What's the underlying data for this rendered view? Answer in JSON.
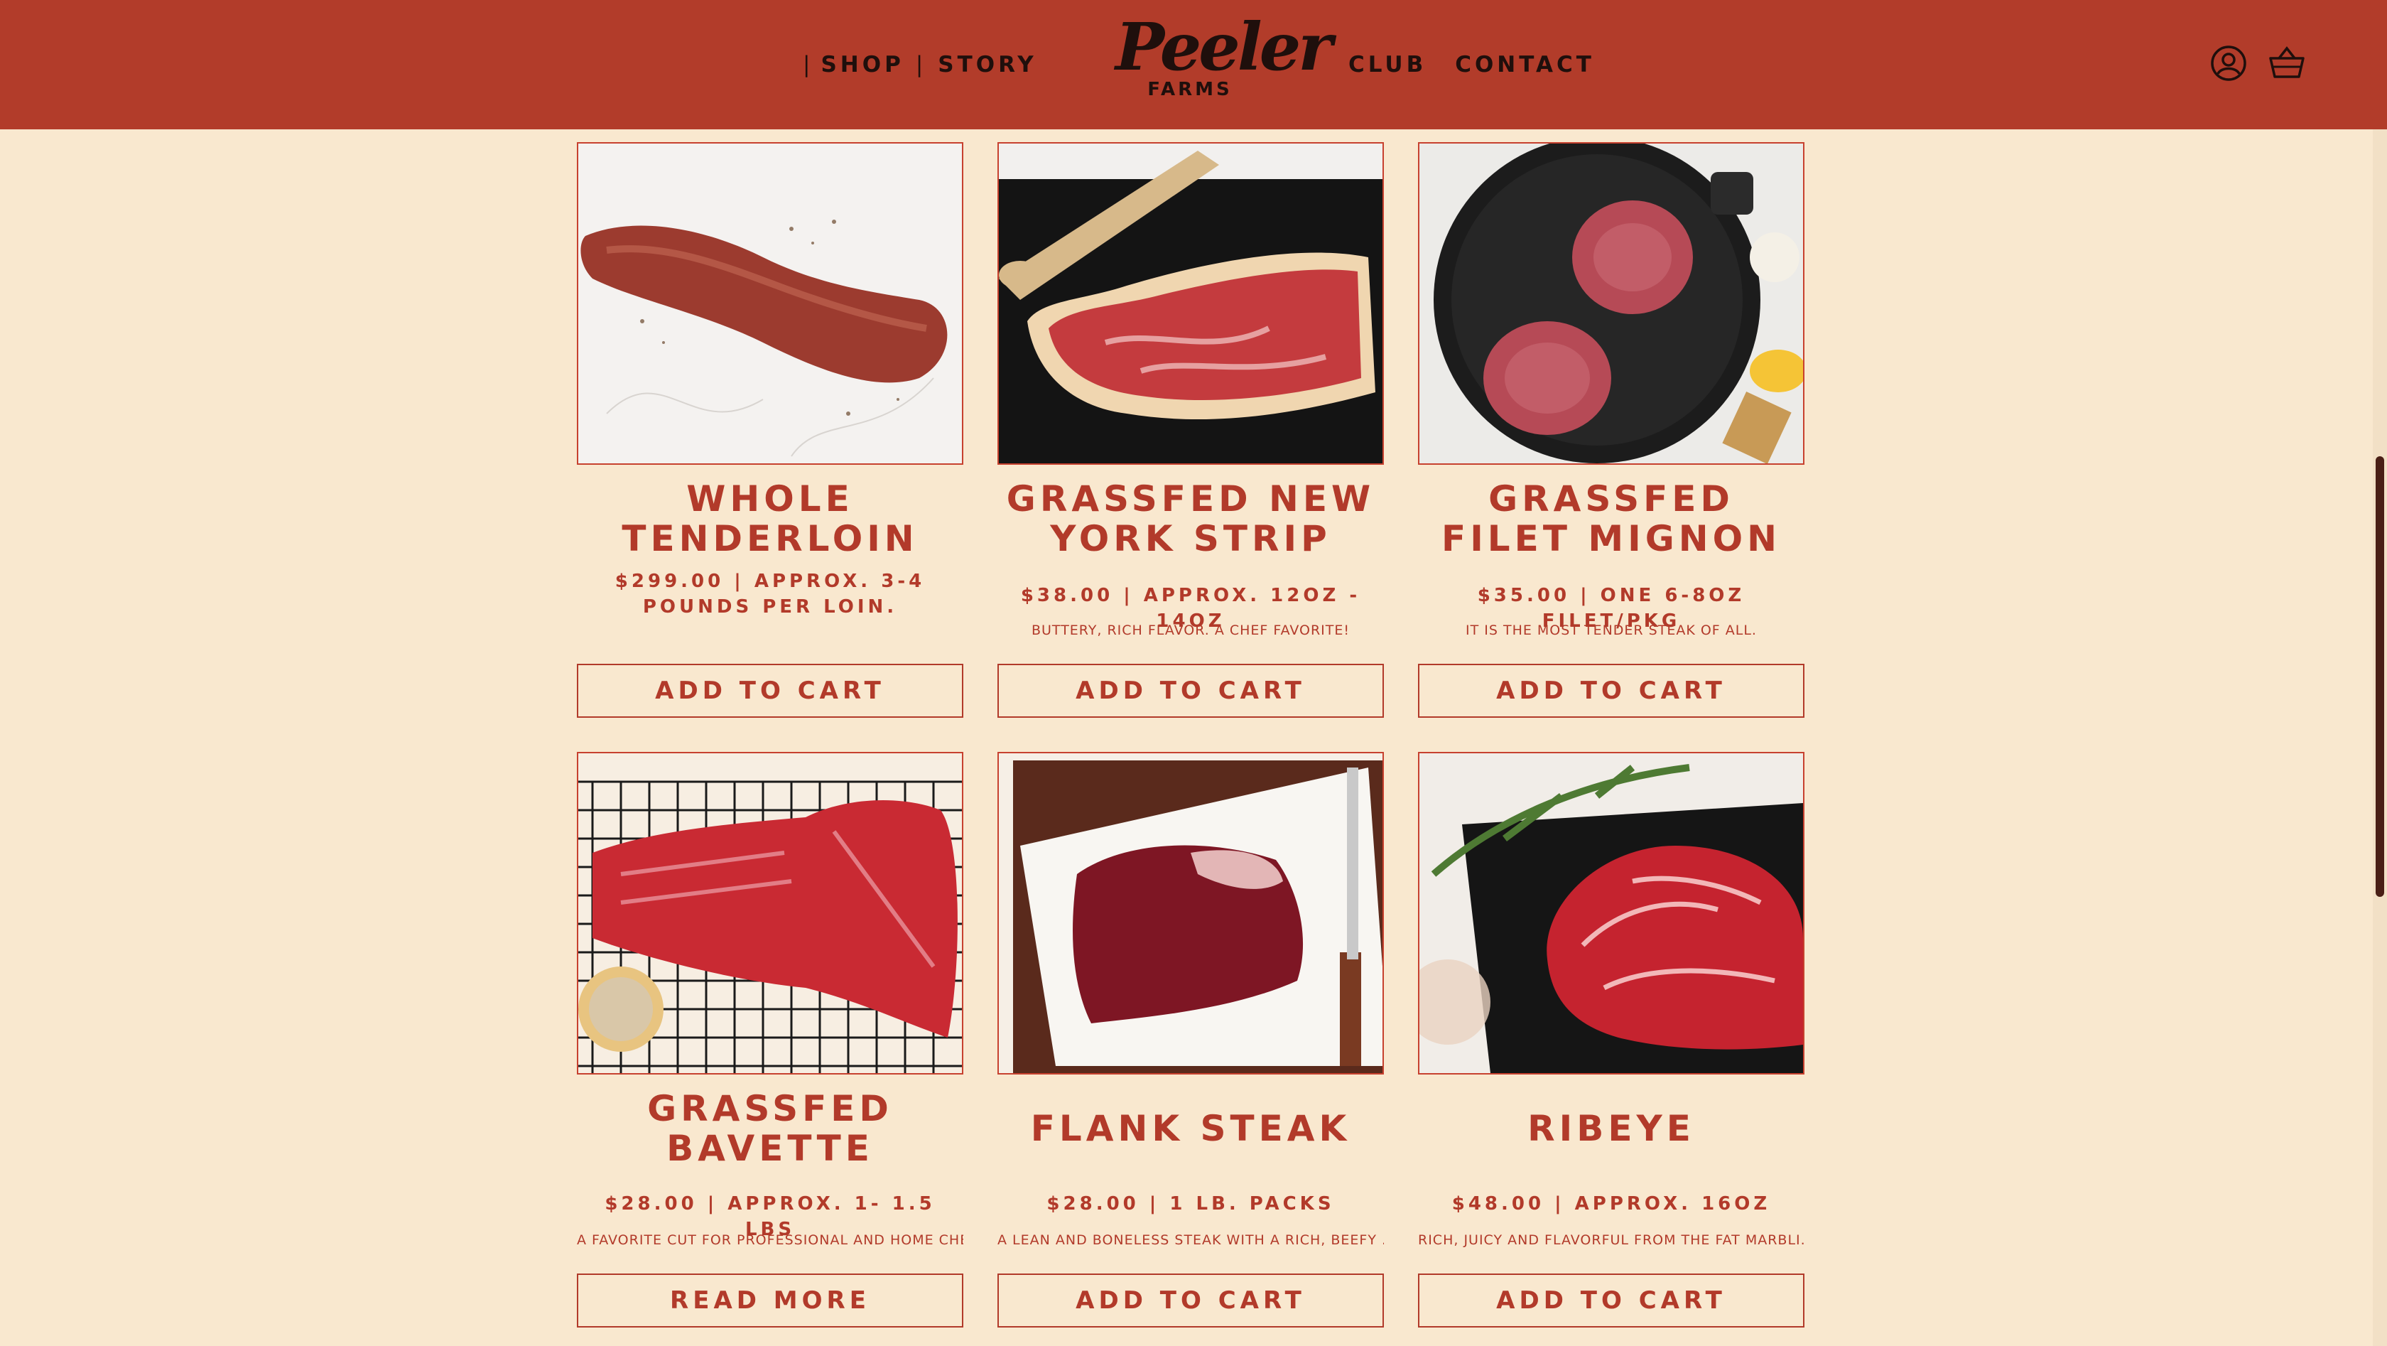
{
  "nav": {
    "sep1": "|",
    "shop": "SHOP",
    "sep2": "|",
    "story": "STORY",
    "club": "CLUB",
    "contact": "CONTACT"
  },
  "logo": {
    "script": "Peeler",
    "farms": "FARMS"
  },
  "icons": {
    "account": "user-circle-icon",
    "cart": "basket-icon"
  },
  "colors": {
    "header": "#b23c2a",
    "background": "#f9e8cf",
    "accent": "#b23a2a",
    "nav_text": "#1f0f0c"
  },
  "products": [
    {
      "title": "WHOLE TENDERLOIN",
      "price": "$299.00 | APPROX. 3-4 POUNDS PER LOIN.",
      "description": "",
      "button": "ADD TO CART"
    },
    {
      "title": "GRASSFED NEW YORK STRIP",
      "price": "$38.00 | APPROX. 12OZ - 14OZ",
      "description": "BUTTERY, RICH FLAVOR. A CHEF FAVORITE!",
      "button": "ADD TO CART"
    },
    {
      "title": "GRASSFED FILET MIGNON",
      "price": "$35.00 | ONE 6-8OZ FILET/PKG",
      "description": "IT IS THE MOST TENDER STEAK OF ALL.",
      "button": "ADD TO CART"
    },
    {
      "title": "GRASSFED BAVETTE",
      "price": "$28.00 | APPROX. 1- 1.5 LBS",
      "description": "A FAVORITE CUT FOR PROFESSIONAL AND HOME CHEF...",
      "button": "READ MORE"
    },
    {
      "title": "FLANK STEAK",
      "price": "$28.00 | 1 LB. PACKS",
      "description": "A LEAN AND BONELESS STEAK WITH A RICH, BEEFY ...",
      "button": "ADD TO CART"
    },
    {
      "title": "RIBEYE",
      "price": "$48.00 | APPROX. 16OZ",
      "description": "RICH, JUICY AND FLAVORFUL FROM THE FAT MARBLI...",
      "button": "ADD TO CART"
    }
  ]
}
